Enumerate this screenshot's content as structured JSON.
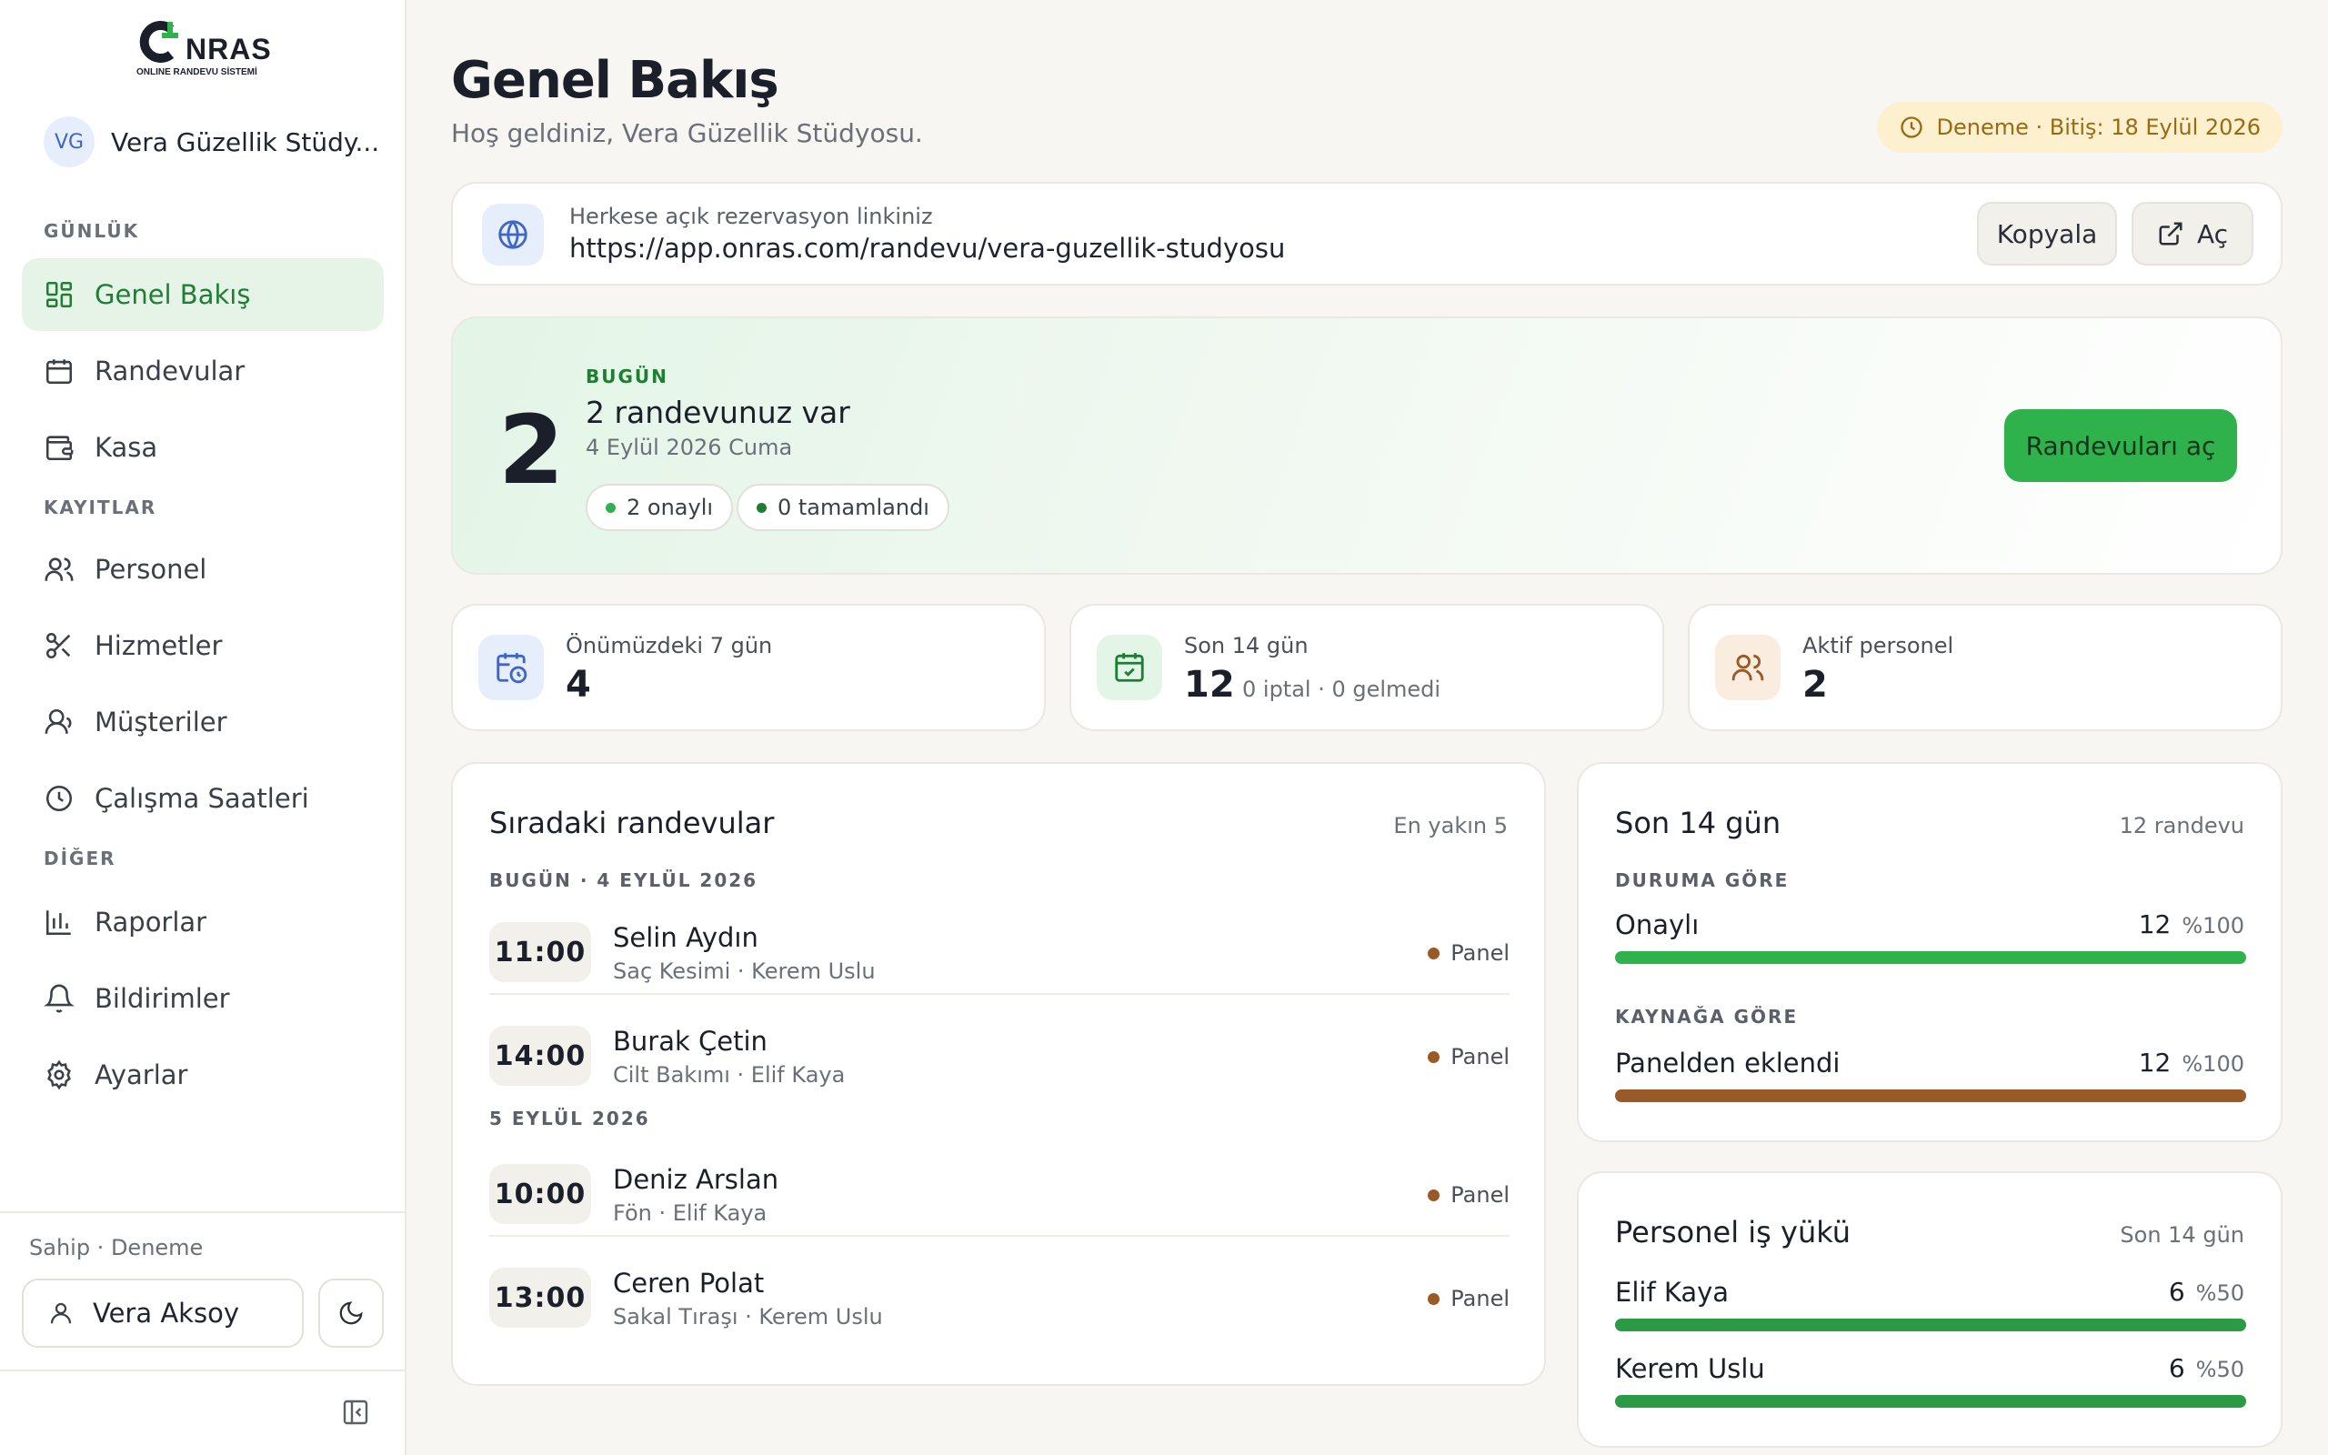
{
  "brand": {
    "logo_text": "C NRAS",
    "logo_sub": "ONLINE RANDEVU SİSTEMİ"
  },
  "workspace": {
    "initials": "VG",
    "name": "Vera Güzellik Stüdy..."
  },
  "sidebar": {
    "sections": [
      "GÜNLÜK",
      "KAYITLAR",
      "DİĞER"
    ],
    "items": [
      {
        "label": "Genel Bakış",
        "icon": "dashboard-icon",
        "active": true
      },
      {
        "label": "Randevular",
        "icon": "calendar-icon"
      },
      {
        "label": "Kasa",
        "icon": "wallet-icon"
      },
      {
        "label": "Personel",
        "icon": "users-icon"
      },
      {
        "label": "Hizmetler",
        "icon": "scissors-icon"
      },
      {
        "label": "Müşteriler",
        "icon": "customers-icon"
      },
      {
        "label": "Çalışma Saatleri",
        "icon": "clock-icon"
      },
      {
        "label": "Raporlar",
        "icon": "bar-chart-icon"
      },
      {
        "label": "Bildirimler",
        "icon": "bell-icon"
      },
      {
        "label": "Ayarlar",
        "icon": "gear-icon"
      }
    ]
  },
  "footer": {
    "role": "Sahip · Deneme",
    "user": "Vera Aksoy"
  },
  "header": {
    "title": "Genel Bakış",
    "subtitle": "Hoş geldiniz, Vera Güzellik Stüdyosu.",
    "trial": "Deneme · Bitiş: 18 Eylül 2026"
  },
  "link": {
    "label": "Herkese açık rezervasyon linkiniz",
    "url": "https://app.onras.com/randevu/vera-guzellik-studyosu",
    "copy_label": "Kopyala",
    "open_label": "Aç"
  },
  "today": {
    "count": "2",
    "eyebrow": "BUGÜN",
    "title": "2 randevunuz var",
    "date": "4 Eylül 2026 Cuma",
    "confirmed": "2 onaylı",
    "completed": "0 tamamlandı",
    "button": "Randevuları aç"
  },
  "stats": [
    {
      "label": "Önümüzdeki 7 gün",
      "value": "4",
      "extra": ""
    },
    {
      "label": "Son 14 gün",
      "value": "12",
      "extra": "0 iptal · 0 gelmedi"
    },
    {
      "label": "Aktif personel",
      "value": "2",
      "extra": ""
    }
  ],
  "upcoming": {
    "title": "Sıradaki randevular",
    "meta": "En yakın 5",
    "groups": [
      {
        "label": "BUGÜN · 4 EYLÜL 2026"
      },
      {
        "label": "5 EYLÜL 2026"
      }
    ],
    "rows": [
      {
        "time": "11:00",
        "name": "Selin Aydın",
        "detail": "Saç Kesimi · Kerem Uslu",
        "source": "Panel"
      },
      {
        "time": "14:00",
        "name": "Burak Çetin",
        "detail": "Cilt Bakımı · Elif Kaya",
        "source": "Panel"
      },
      {
        "time": "10:00",
        "name": "Deniz Arslan",
        "detail": "Fön · Elif Kaya",
        "source": "Panel"
      },
      {
        "time": "13:00",
        "name": "Ceren Polat",
        "detail": "Sakal Tıraşı · Kerem Uslu",
        "source": "Panel"
      }
    ]
  },
  "last14": {
    "title": "Son 14 gün",
    "meta": "12 randevu",
    "by_status_label": "DURUMA GÖRE",
    "status": {
      "label": "Onaylı",
      "value": "12",
      "pct": "%100",
      "fraction": 1.0,
      "color": "#2fb24b"
    },
    "by_source_label": "KAYNAĞA GÖRE",
    "source": {
      "label": "Panelden eklendi",
      "value": "12",
      "pct": "%100",
      "fraction": 1.0,
      "color": "#9a5a28"
    }
  },
  "workload": {
    "title": "Personel iş yükü",
    "meta": "Son 14 gün",
    "rows": [
      {
        "name": "Elif Kaya",
        "value": "6",
        "pct": "%50",
        "fraction": 1.0,
        "color": "#2a9b44"
      },
      {
        "name": "Kerem Uslu",
        "value": "6",
        "pct": "%50",
        "fraction": 1.0,
        "color": "#2a9b44"
      }
    ]
  },
  "colors": {
    "accent": "#2fb24b",
    "active_bg": "#e6f4e8",
    "trial_bg": "#fcf0cf",
    "panel_dot": "#9a5a28"
  }
}
